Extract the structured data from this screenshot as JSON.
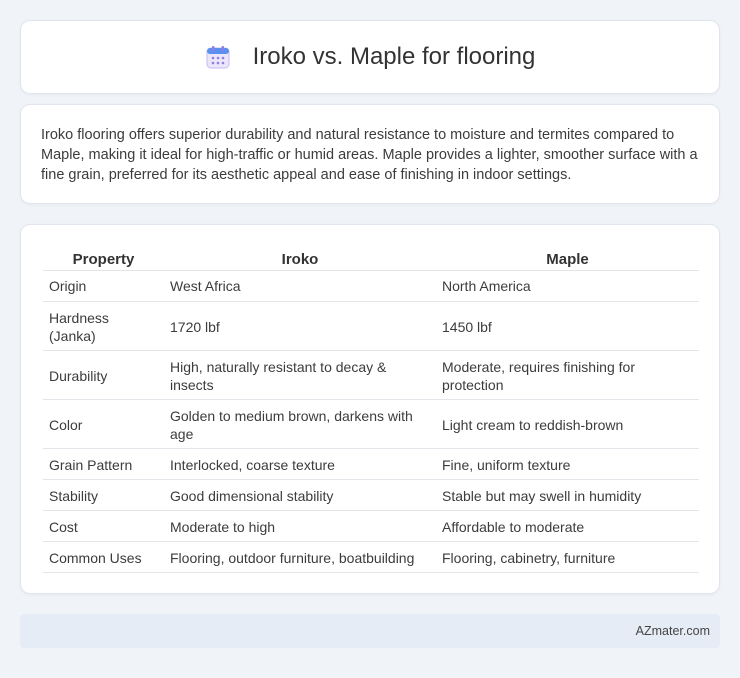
{
  "header": {
    "title": "Iroko vs. Maple for flooring",
    "icon": "calendar-icon"
  },
  "summary": {
    "text": "Iroko flooring offers superior durability and natural resistance to moisture and termites compared to Maple, making it ideal for high-traffic or humid areas. Maple provides a lighter, smoother surface with a fine grain, preferred for its aesthetic appeal and ease of finishing in indoor settings."
  },
  "table": {
    "headers": [
      "Property",
      "Iroko",
      "Maple"
    ],
    "rows": [
      [
        "Origin",
        "West Africa",
        "North America"
      ],
      [
        "Hardness (Janka)",
        "1720 lbf",
        "1450 lbf"
      ],
      [
        "Durability",
        "High, naturally resistant to decay & insects",
        "Moderate, requires finishing for protection"
      ],
      [
        "Color",
        "Golden to medium brown, darkens with age",
        "Light cream to reddish-brown"
      ],
      [
        "Grain Pattern",
        "Interlocked, coarse texture",
        "Fine, uniform texture"
      ],
      [
        "Stability",
        "Good dimensional stability",
        "Stable but may swell in humidity"
      ],
      [
        "Cost",
        "Moderate to high",
        "Affordable to moderate"
      ],
      [
        "Common Uses",
        "Flooring, outdoor furniture, boatbuilding",
        "Flooring, cabinetry, furniture"
      ]
    ]
  },
  "footer": {
    "brand": "AZmater.com"
  }
}
